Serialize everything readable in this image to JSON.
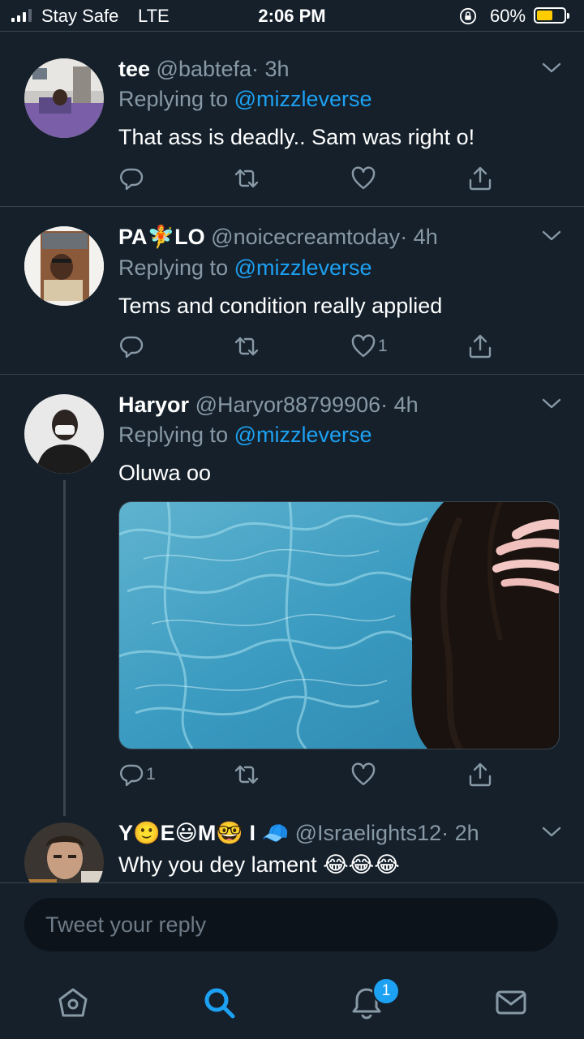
{
  "status_bar": {
    "carrier": "Stay Safe",
    "network": "LTE",
    "time": "2:06 PM",
    "battery_percent": "60%",
    "battery_level": 0.6
  },
  "tweets": [
    {
      "name": "tee",
      "handle": "@babtefa",
      "time": "· 3h",
      "replying_prefix": "Replying to",
      "replying_to": "@mizzleverse",
      "text": "That ass is deadly..  Sam was right o!",
      "reply_count": "",
      "like_count": ""
    },
    {
      "name_part1": "PA",
      "name_emoji": "🧚",
      "name_part2": "LO",
      "handle": "@noicecreamtoday",
      "time": "· 4h",
      "replying_prefix": "Replying to",
      "replying_to": "@mizzleverse",
      "text": "Tems and condition really applied",
      "reply_count": "",
      "like_count": "1"
    },
    {
      "name": "Haryor",
      "handle": "@Haryor88799906",
      "time": "· 4h",
      "replying_prefix": "Replying to",
      "replying_to": "@mizzleverse",
      "text": "Oluwa oo",
      "reply_count": "1",
      "like_count": ""
    },
    {
      "name_letters": [
        "Y",
        "E",
        "M",
        "I"
      ],
      "name_emojis": [
        "🙂",
        "😃",
        "🤓",
        "🧢"
      ],
      "handle": "@Israelights12",
      "time": "· 2h",
      "text": "Why you dey lament",
      "text_emojis": "😂😂😂"
    }
  ],
  "composer": {
    "placeholder": "Tweet your reply"
  },
  "tabbar": {
    "items": [
      "home-icon",
      "search-icon",
      "notifications-icon",
      "messages-icon"
    ],
    "notifications_badge": "1"
  },
  "colors": {
    "background": "#15202b",
    "accent": "#1da1f2",
    "secondary_text": "#8899a6",
    "divider": "#38444d",
    "battery": "#ffcc00"
  }
}
